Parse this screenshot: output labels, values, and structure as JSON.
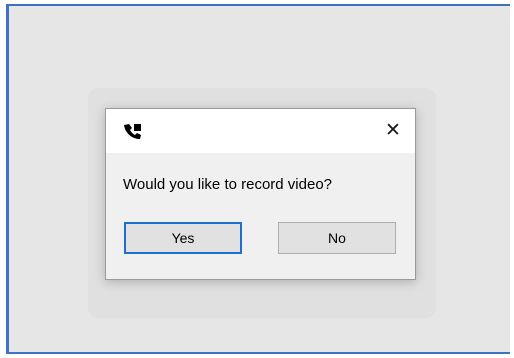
{
  "dialog": {
    "icon": "phone-handset-icon",
    "close_label": "✕",
    "message": "Would you like to record video?",
    "buttons": {
      "yes_label": "Yes",
      "no_label": "No"
    }
  },
  "colors": {
    "window_border": "#3f72c4",
    "default_button_border": "#1f6fd0",
    "dialog_background": "#f0f0f0",
    "titlebar_background": "#ffffff"
  }
}
